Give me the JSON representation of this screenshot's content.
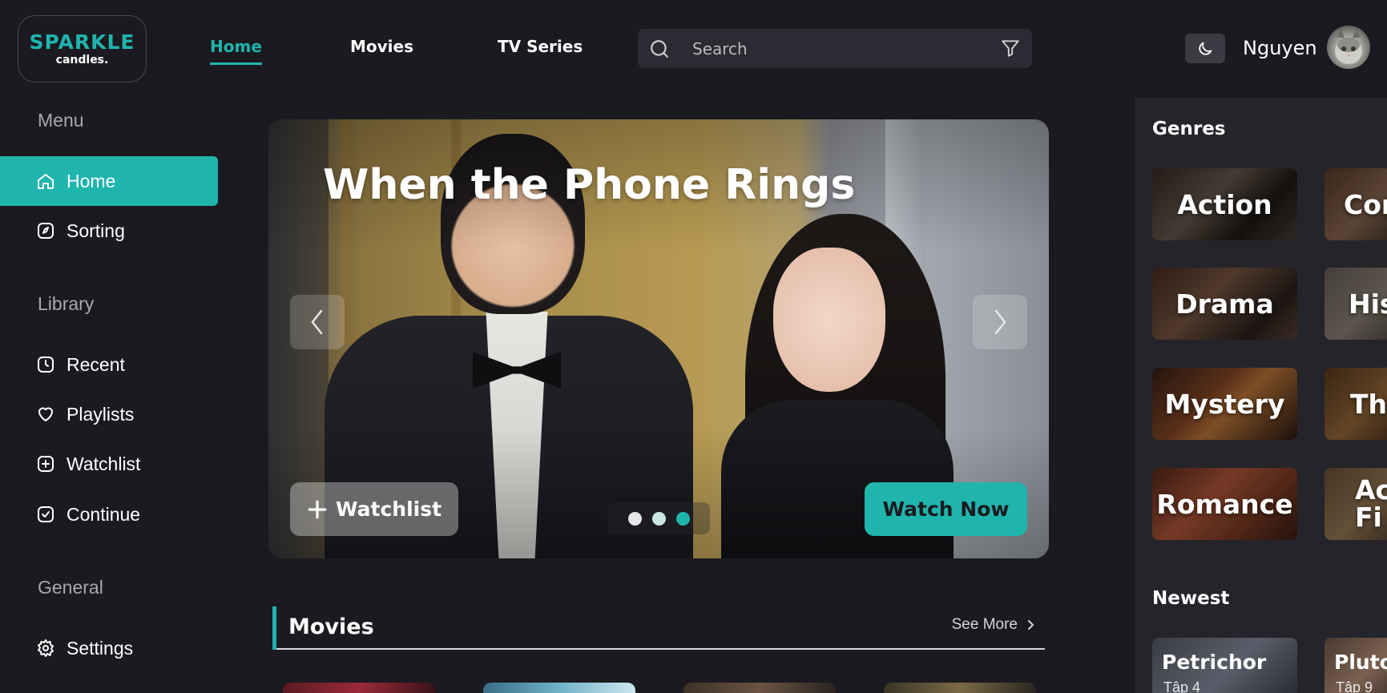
{
  "brand": {
    "line1": "SPARKLE",
    "line2": "candles."
  },
  "topnav": [
    {
      "label": "Home",
      "active": true
    },
    {
      "label": "Movies",
      "active": false
    },
    {
      "label": "TV Series",
      "active": false
    }
  ],
  "search": {
    "placeholder": "Search",
    "value": ""
  },
  "user": {
    "name": "Nguyen"
  },
  "sidebar": {
    "menu_heading": "Menu",
    "menu": [
      {
        "label": "Home",
        "icon": "home-icon",
        "active": true
      },
      {
        "label": "Sorting",
        "icon": "compass-icon",
        "active": false
      }
    ],
    "library_heading": "Library",
    "library": [
      {
        "label": "Recent",
        "icon": "clock-icon"
      },
      {
        "label": "Playlists",
        "icon": "heart-icon"
      },
      {
        "label": "Watchlist",
        "icon": "plus-square-icon"
      },
      {
        "label": "Continue",
        "icon": "check-square-icon"
      }
    ],
    "general_heading": "General",
    "general": [
      {
        "label": "Settings",
        "icon": "gear-icon"
      }
    ]
  },
  "hero": {
    "title": "When the Phone Rings",
    "watchlist_label": "Watchlist",
    "watch_now_label": "Watch Now",
    "slides": 3,
    "active_slide": 3
  },
  "movies": {
    "title": "Movies",
    "see_more": "See More"
  },
  "genres": {
    "title": "Genres",
    "items": [
      "Action",
      "Con",
      "Drama",
      "His",
      "Mystery",
      "Thr",
      "Romance",
      "Ac Fi"
    ]
  },
  "newest": {
    "title": "Newest",
    "items": [
      {
        "title": "Petrichor",
        "sub": "Tập 4"
      },
      {
        "title": "Pluto",
        "sub": "Tập 9"
      }
    ]
  },
  "colors": {
    "accent": "#1fb5ad",
    "background": "#1b1a20",
    "panel": "#25242b"
  }
}
